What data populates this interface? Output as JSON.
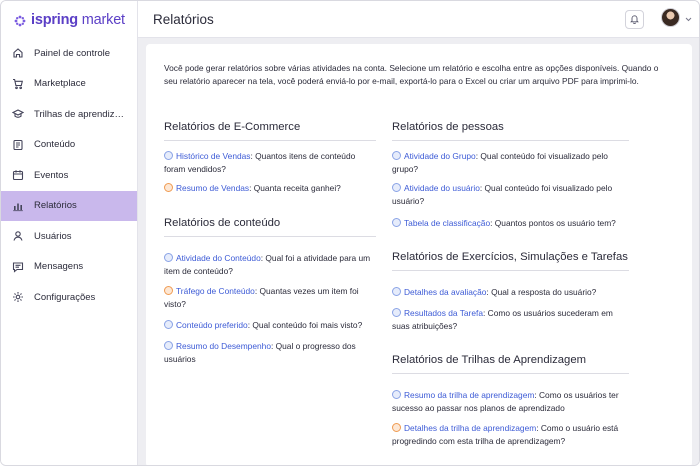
{
  "app": {
    "logo_bold": "ispring",
    "logo_light": " market",
    "brand_color": "#5b3fc6",
    "active_color": "#c9b8ec"
  },
  "sidebar": {
    "items": [
      {
        "label": "Painel de controle",
        "icon": "home-icon"
      },
      {
        "label": "Marketplace",
        "icon": "cart-icon"
      },
      {
        "label": "Trilhas de aprendizag…",
        "icon": "graduation-cap-icon"
      },
      {
        "label": "Conteúdo",
        "icon": "document-icon"
      },
      {
        "label": "Eventos",
        "icon": "calendar-icon"
      },
      {
        "label": "Relatórios",
        "icon": "bar-chart-icon",
        "active": true
      },
      {
        "label": "Usuários",
        "icon": "user-icon"
      },
      {
        "label": "Mensagens",
        "icon": "message-icon"
      },
      {
        "label": "Configurações",
        "icon": "gear-icon"
      }
    ]
  },
  "header": {
    "title": "Relatórios"
  },
  "main": {
    "intro": "Você pode gerar relatórios sobre várias atividades na conta. Selecione um relatório e escolha entre as opções disponíveis. Quando o seu relatório aparecer na tela, você poderá enviá-lo por e-mail, exportá-lo para o Excel ou criar um arquivo PDF para imprimi-lo.",
    "ecommerce": {
      "title": "Relatórios de E-Commerce",
      "items": [
        {
          "link": "Histórico de Vendas",
          "text": ": Quantos itens de conteúdo foram vendidos?"
        },
        {
          "link": "Resumo de Vendas",
          "text": ": Quanta receita ganhei?"
        }
      ]
    },
    "content": {
      "title": "Relatórios de conteúdo",
      "items": [
        {
          "link": "Atividade do Conteúdo",
          "text": ": Qual foi a atividade para um item de conteúdo?"
        },
        {
          "link": "Tráfego de Conteúdo",
          "text": ": Quantas vezes um item foi visto?"
        },
        {
          "link": "Conteúdo preferido",
          "text": ": Qual conteúdo foi mais visto?"
        },
        {
          "link": "Resumo do Desempenho",
          "text": ": Qual o progresso dos usuários"
        }
      ]
    },
    "people": {
      "title": "Relatórios de pessoas",
      "items": [
        {
          "link": "Atividade do Grupo",
          "text": ": Qual conteúdo foi visualizado pelo grupo?"
        },
        {
          "link": "Atividade do usuário",
          "text": ": Qual conteúdo foi visualizado pelo usuário?"
        },
        {
          "link": "Tabela de classificação",
          "text": ": Quantos pontos os usuário tem?"
        }
      ]
    },
    "exercises": {
      "title": "Relatórios de Exercícios, Simulações e Tarefas",
      "items": [
        {
          "link": "Detalhes da avaliação",
          "text": ": Qual a resposta do usuário?"
        },
        {
          "link": "Resultados da Tarefa",
          "text": ": Como os usuários sucederam em suas atribuições?"
        }
      ]
    },
    "paths": {
      "title": "Relatórios de Trilhas de Aprendizagem",
      "items": [
        {
          "link": "Resumo da trilha de aprendizagem",
          "text": ": Como os usuários ter sucesso ao passar nos planos de aprendizado"
        },
        {
          "link": "Detalhes da trilha de aprendizagem",
          "text": ": Como o usuário está progredindo com esta trilha de aprendizagem?"
        }
      ]
    }
  }
}
